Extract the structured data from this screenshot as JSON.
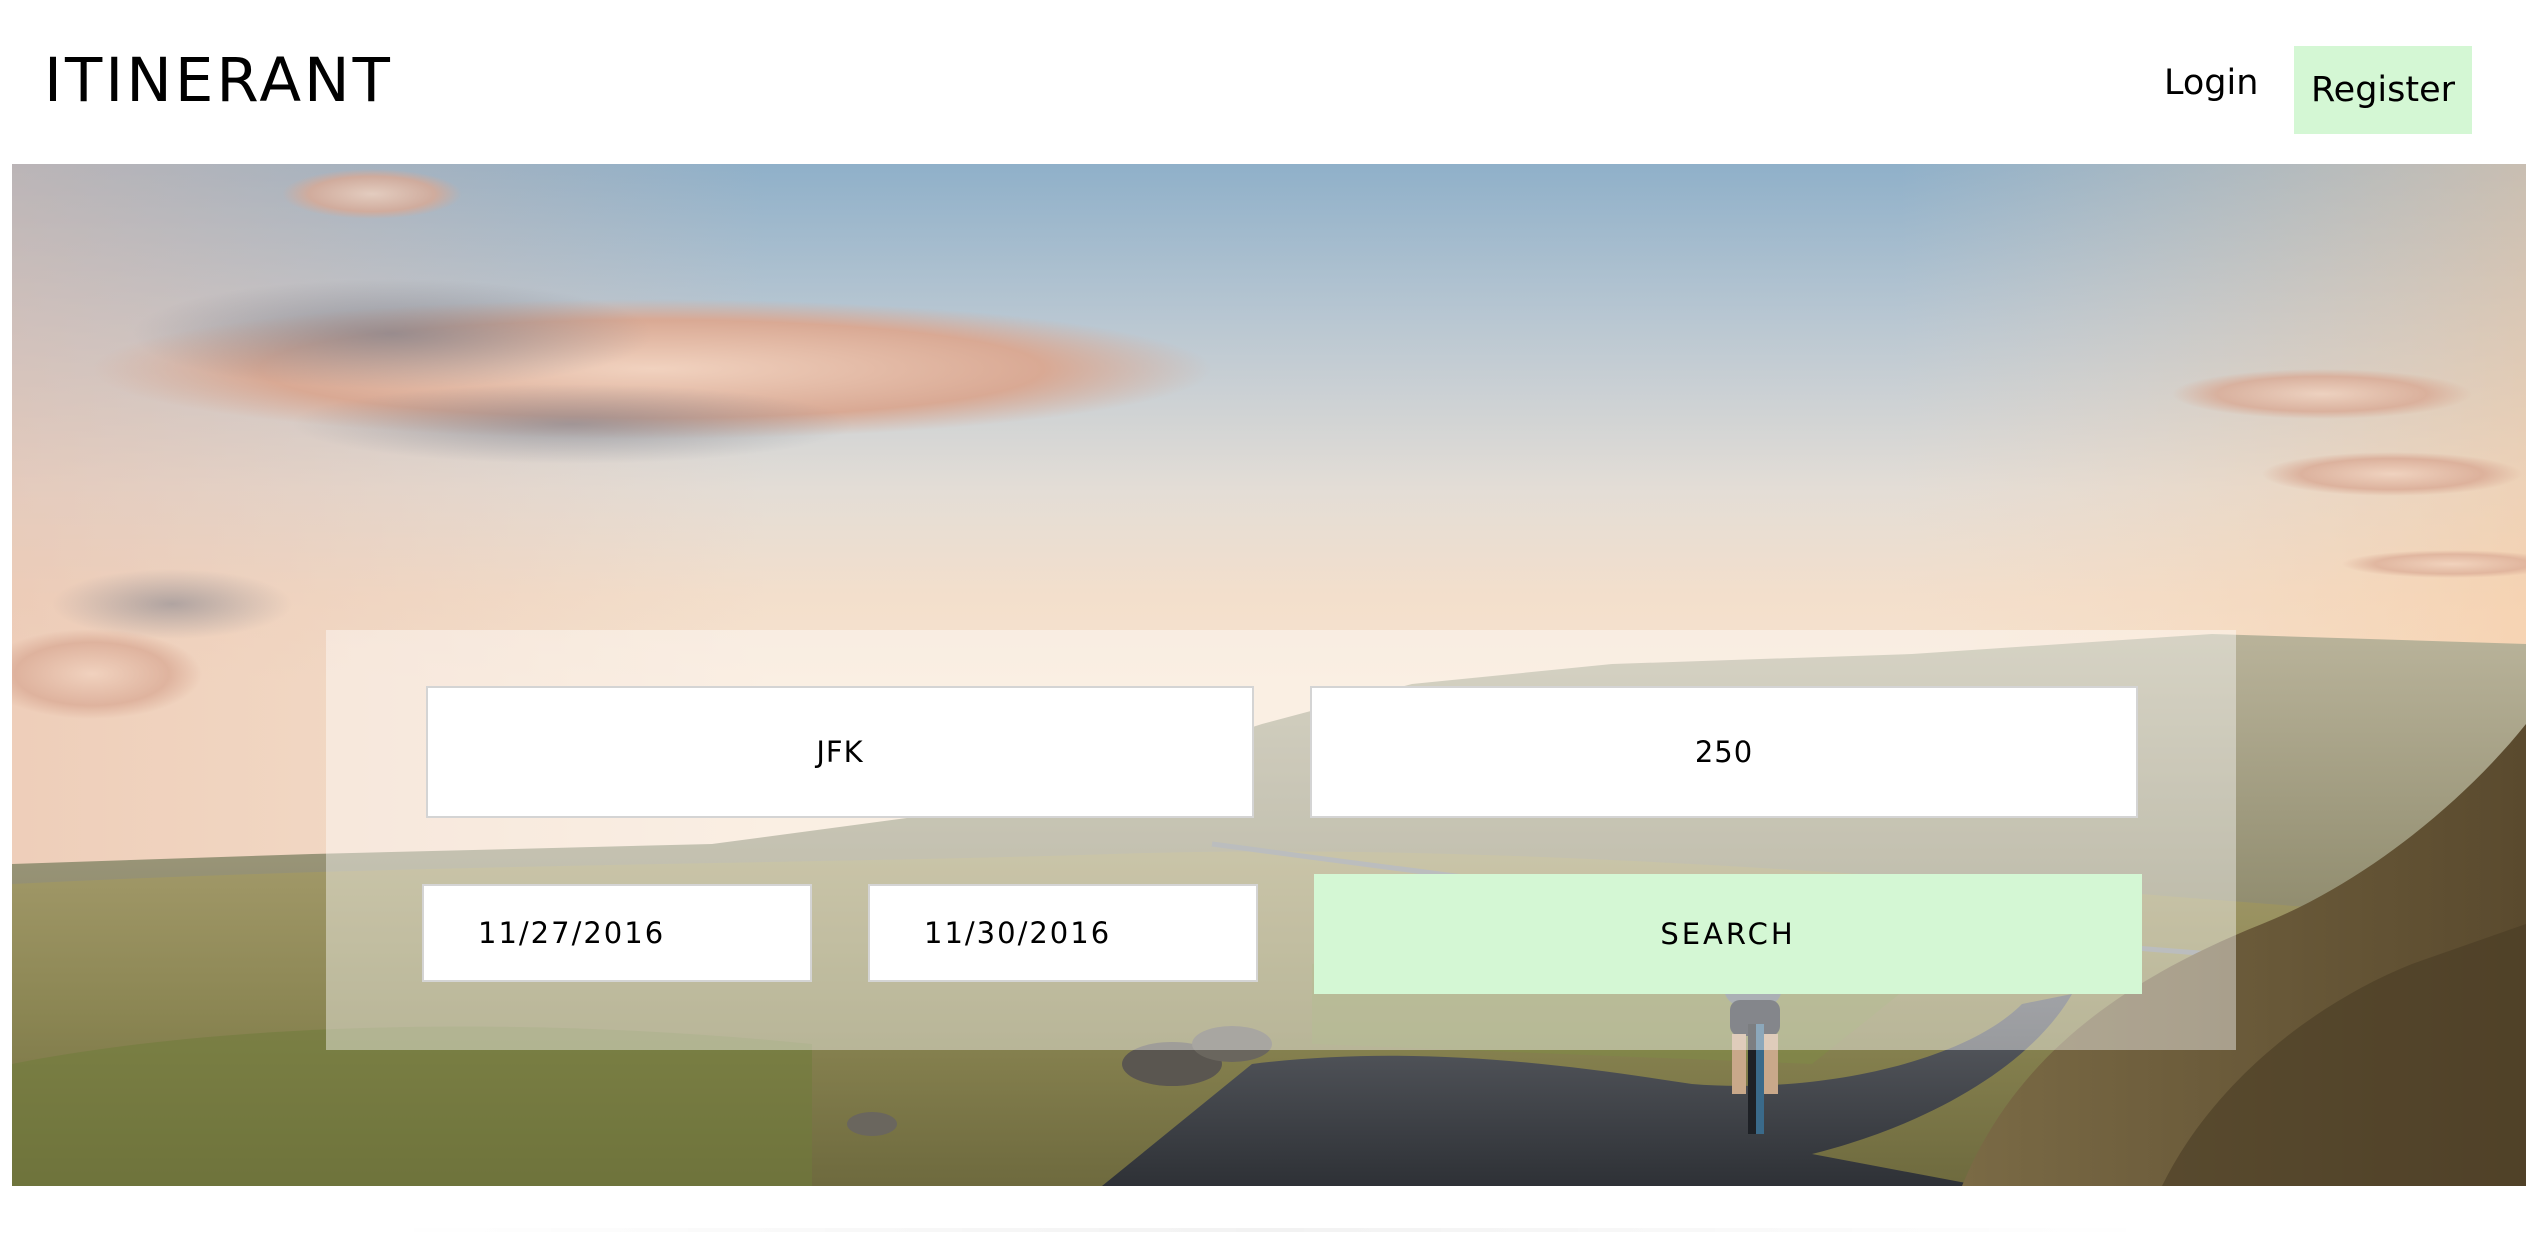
{
  "header": {
    "logo_text": "ITINERANT",
    "login_label": "Login",
    "register_label": "Register"
  },
  "hero": {
    "image_description_icon": "landscape-photo"
  },
  "search": {
    "origin_value": "JFK",
    "budget_value": "250",
    "depart_date_value": "11/27/2016",
    "return_date_value": "11/30/2016",
    "search_label": "SEARCH"
  },
  "colors": {
    "accent_green": "#d4f7d4",
    "field_border": "#d4d4d4"
  }
}
